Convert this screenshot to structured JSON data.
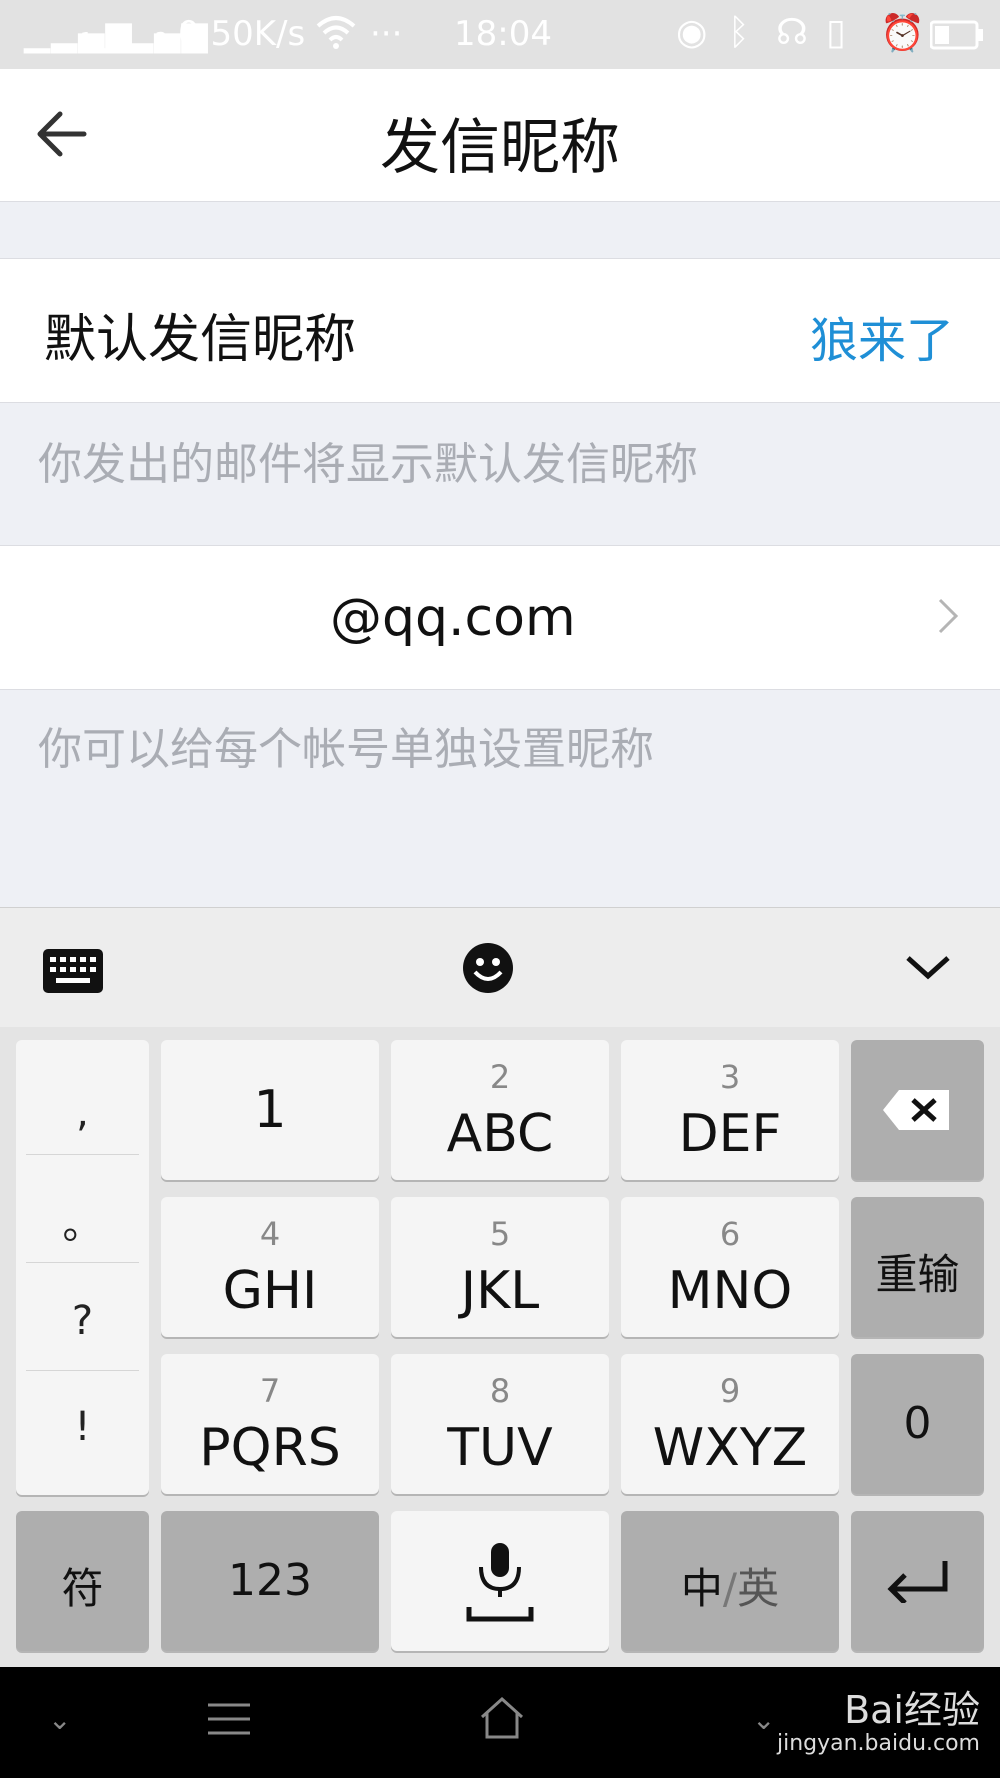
{
  "status_bar": {
    "signal1": "▁▂▄▆",
    "sim1": "1",
    "signal2": "▁▂▄▆",
    "sim2": "2",
    "speed": "0.50K/s",
    "more": "···",
    "time": "18:04",
    "icons": [
      "location-icon",
      "bluetooth-icon",
      "headset-icon",
      "vibrate-icon",
      "alarm-icon",
      "battery-icon"
    ]
  },
  "nav": {
    "title": "发信昵称"
  },
  "default_nickname": {
    "label": "默认发信昵称",
    "value": "狼来了",
    "hint": "你发出的邮件将显示默认发信昵称"
  },
  "account": {
    "email": "@qq.com",
    "hint": "你可以给每个帐号单独设置昵称"
  },
  "keyboard": {
    "punct": [
      ",",
      "。",
      "?",
      "!"
    ],
    "rows": [
      [
        {
          "num": "",
          "letters": "1"
        },
        {
          "num": "2",
          "letters": "ABC"
        },
        {
          "num": "3",
          "letters": "DEF"
        }
      ],
      [
        {
          "num": "4",
          "letters": "GHI"
        },
        {
          "num": "5",
          "letters": "JKL"
        },
        {
          "num": "6",
          "letters": "MNO"
        }
      ],
      [
        {
          "num": "7",
          "letters": "PQRS"
        },
        {
          "num": "8",
          "letters": "TUV"
        },
        {
          "num": "9",
          "letters": "WXYZ"
        }
      ]
    ],
    "reinput": "重输",
    "zero": "0",
    "symbol": "符",
    "num123": "123",
    "lang_zh": "中",
    "lang_sep": "/",
    "lang_en": "英"
  },
  "watermark": {
    "brand": "Bai经验",
    "url": "jingyan.baidu.com"
  },
  "colors": {
    "accent": "#1f8fd6",
    "hint": "#aaadb4"
  }
}
